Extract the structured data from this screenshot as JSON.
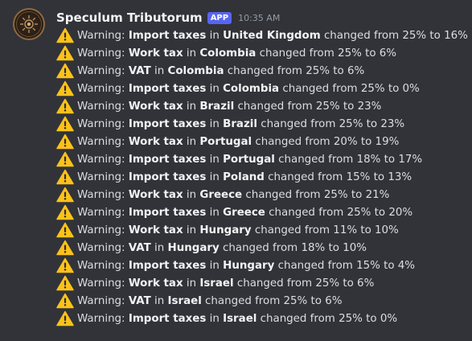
{
  "message": {
    "author": "Speculum Tributorum",
    "badge": "APP",
    "timestamp": "10:35 AM",
    "avatar_icon": "sun-emblem-icon",
    "line_icon": "warning-icon",
    "colors": {
      "background": "#313338",
      "text": "#dbdee1",
      "bold_text": "#f2f3f5",
      "badge": "#5865f2",
      "timestamp": "#949ba4",
      "warning": "#fcc21b"
    },
    "lines": [
      {
        "prefix": "Warning:",
        "tax": "Import taxes",
        "in": "in",
        "country": "United Kingdom",
        "change": "changed from 25% to 16%"
      },
      {
        "prefix": "Warning:",
        "tax": "Work tax",
        "in": "in",
        "country": "Colombia",
        "change": "changed from 25% to 6%"
      },
      {
        "prefix": "Warning:",
        "tax": "VAT",
        "in": "in",
        "country": "Colombia",
        "change": "changed from 25% to 6%"
      },
      {
        "prefix": "Warning:",
        "tax": "Import taxes",
        "in": "in",
        "country": "Colombia",
        "change": "changed from 25% to 0%"
      },
      {
        "prefix": "Warning:",
        "tax": "Work tax",
        "in": "in",
        "country": "Brazil",
        "change": "changed from 25% to 23%"
      },
      {
        "prefix": "Warning:",
        "tax": "Import taxes",
        "in": "in",
        "country": "Brazil",
        "change": "changed from 25% to 23%"
      },
      {
        "prefix": "Warning:",
        "tax": "Work tax",
        "in": "in",
        "country": "Portugal",
        "change": "changed from 20% to 19%"
      },
      {
        "prefix": "Warning:",
        "tax": "Import taxes",
        "in": "in",
        "country": "Portugal",
        "change": "changed from 18% to 17%"
      },
      {
        "prefix": "Warning:",
        "tax": "Import taxes",
        "in": "in",
        "country": "Poland",
        "change": "changed from 15% to 13%"
      },
      {
        "prefix": "Warning:",
        "tax": "Work tax",
        "in": "in",
        "country": "Greece",
        "change": "changed from 25% to 21%"
      },
      {
        "prefix": "Warning:",
        "tax": "Import taxes",
        "in": "in",
        "country": "Greece",
        "change": "changed from 25% to 20%"
      },
      {
        "prefix": "Warning:",
        "tax": "Work tax",
        "in": "in",
        "country": "Hungary",
        "change": "changed from 11% to 10%"
      },
      {
        "prefix": "Warning:",
        "tax": "VAT",
        "in": "in",
        "country": "Hungary",
        "change": "changed from 18% to 10%"
      },
      {
        "prefix": "Warning:",
        "tax": "Import taxes",
        "in": "in",
        "country": "Hungary",
        "change": "changed from 15% to 4%"
      },
      {
        "prefix": "Warning:",
        "tax": "Work tax",
        "in": "in",
        "country": "Israel",
        "change": "changed from 25% to 6%"
      },
      {
        "prefix": "Warning:",
        "tax": "VAT",
        "in": "in",
        "country": "Israel",
        "change": "changed from 25% to 6%"
      },
      {
        "prefix": "Warning:",
        "tax": "Import taxes",
        "in": "in",
        "country": "Israel",
        "change": "changed from 25% to 0%"
      }
    ]
  }
}
